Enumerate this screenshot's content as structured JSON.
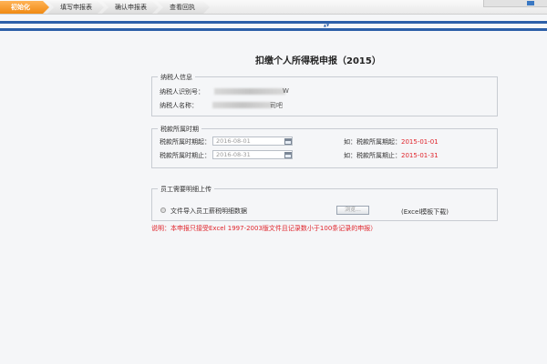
{
  "steps": [
    {
      "label": "初始化",
      "active": true
    },
    {
      "label": "填写申报表",
      "active": false
    },
    {
      "label": "确认申报表",
      "active": false
    },
    {
      "label": "查看回执",
      "active": false
    }
  ],
  "page_title": "扣缴个人所得税申报（2015）",
  "taxpayer": {
    "legend": "纳税人信息",
    "id_label": "纳税人识别号：",
    "id_tail": "W",
    "name_label": "纳税人名称：",
    "name_tail": "司吧"
  },
  "period": {
    "legend": "税款所属时期",
    "start_label": "税款所属时期起：",
    "start_value": "2016-08-01",
    "end_label": "税款所属时期止：",
    "end_value": "2016-08-31",
    "start_hint_prefix": "如：税款所属期起：",
    "start_hint_value": "2015-01-01",
    "end_hint_prefix": "如：税款所属期止：",
    "end_hint_value": "2015-01-31"
  },
  "upload": {
    "legend": "员工需要明细上传",
    "option_label": "文件导入员工薪税明细数据",
    "browse_label": "浏览...",
    "template_link": "(Excel模板下载)"
  },
  "note": "说明：本申报只接受Excel 1997-2003版文件且记录数小于100条记录的申报）",
  "colors": {
    "accent_orange": "#f08a13",
    "stripe_blue": "#2c5fa8",
    "hint_red": "#e0242b"
  }
}
